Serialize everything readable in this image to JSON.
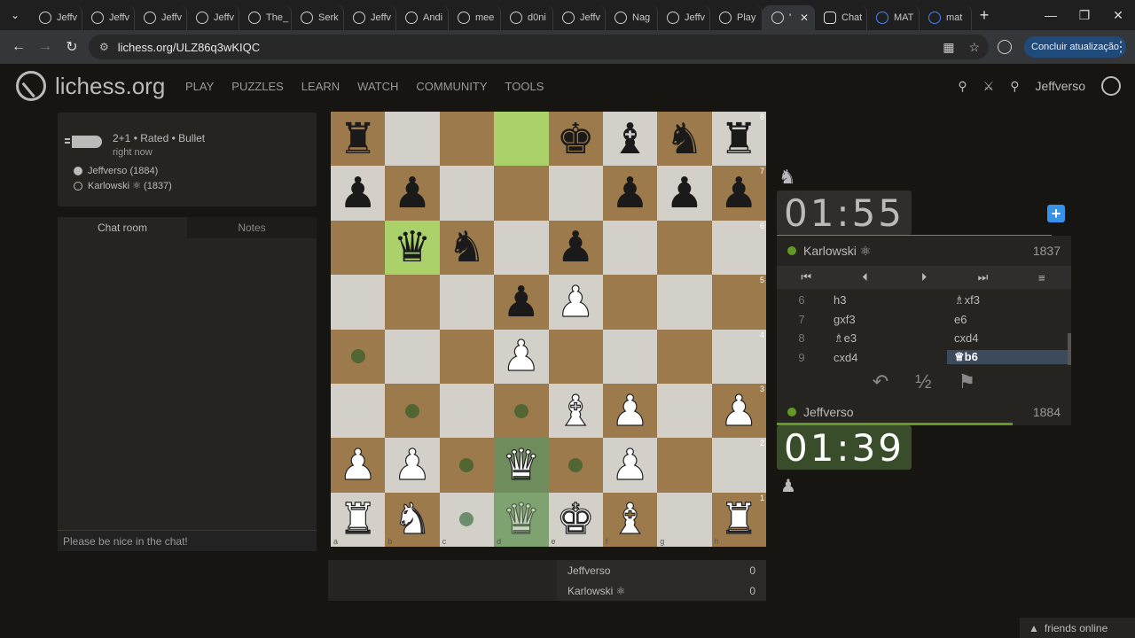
{
  "browser": {
    "tabs": [
      {
        "label": "Jeffv"
      },
      {
        "label": "Jeffv"
      },
      {
        "label": "Jeffv"
      },
      {
        "label": "Jeffv"
      },
      {
        "label": "The_"
      },
      {
        "label": "Serk"
      },
      {
        "label": "Jeffv"
      },
      {
        "label": "Andi"
      },
      {
        "label": "mee"
      },
      {
        "label": "d0ni"
      },
      {
        "label": "Jeffv"
      },
      {
        "label": "Nag"
      },
      {
        "label": "Jeffv"
      },
      {
        "label": "Play"
      },
      {
        "label": "'",
        "active": true
      },
      {
        "label": "Chat"
      },
      {
        "label": "MAT"
      },
      {
        "label": "mat"
      }
    ],
    "url": "lichess.org/ULZ86q3wKIQC",
    "update_label": "Concluir atualização"
  },
  "site": {
    "brand": "lichess.org",
    "nav": [
      "PLAY",
      "PUZZLES",
      "LEARN",
      "WATCH",
      "COMMUNITY",
      "TOOLS"
    ],
    "username": "Jeffverso"
  },
  "game_info": {
    "mode": "2+1 • Rated • Bullet",
    "time": "right now",
    "white": "Jeffverso (1884)",
    "black": "Karlowski ⚛ (1837)"
  },
  "chat": {
    "tabs": [
      "Chat room",
      "Notes"
    ],
    "placeholder": "Please be nice in the chat!"
  },
  "board": {
    "ranks": [
      "8",
      "7",
      "6",
      "5",
      "4",
      "3",
      "2",
      "1"
    ],
    "files": [
      "a",
      "b",
      "c",
      "d",
      "e",
      "f",
      "g",
      "h"
    ]
  },
  "material": [
    {
      "name": "Jeffverso",
      "score": "0"
    },
    {
      "name": "Karlowski ⚛",
      "score": "0"
    }
  ],
  "clocks": {
    "opponent": "01:55",
    "player": "01:39"
  },
  "players": {
    "top": {
      "name": "Karlowski ⚛",
      "rating": "1837"
    },
    "bottom": {
      "name": "Jeffverso",
      "rating": "1884"
    }
  },
  "moves": [
    {
      "num": "6",
      "white": "h3",
      "black": "♗xf3"
    },
    {
      "num": "7",
      "white": "gxf3",
      "black": "e6"
    },
    {
      "num": "8",
      "white": "♗e3",
      "black": "cxd4"
    },
    {
      "num": "9",
      "white": "cxd4",
      "black": "♕b6"
    }
  ],
  "action_labels": {
    "draw": "½"
  },
  "friends": "friends online",
  "icons": {
    "first": "⏮",
    "prev": "⏴",
    "next": "⏵",
    "last": "⏭",
    "menu": "≡",
    "takeback": "↶",
    "resign": "⚑"
  }
}
